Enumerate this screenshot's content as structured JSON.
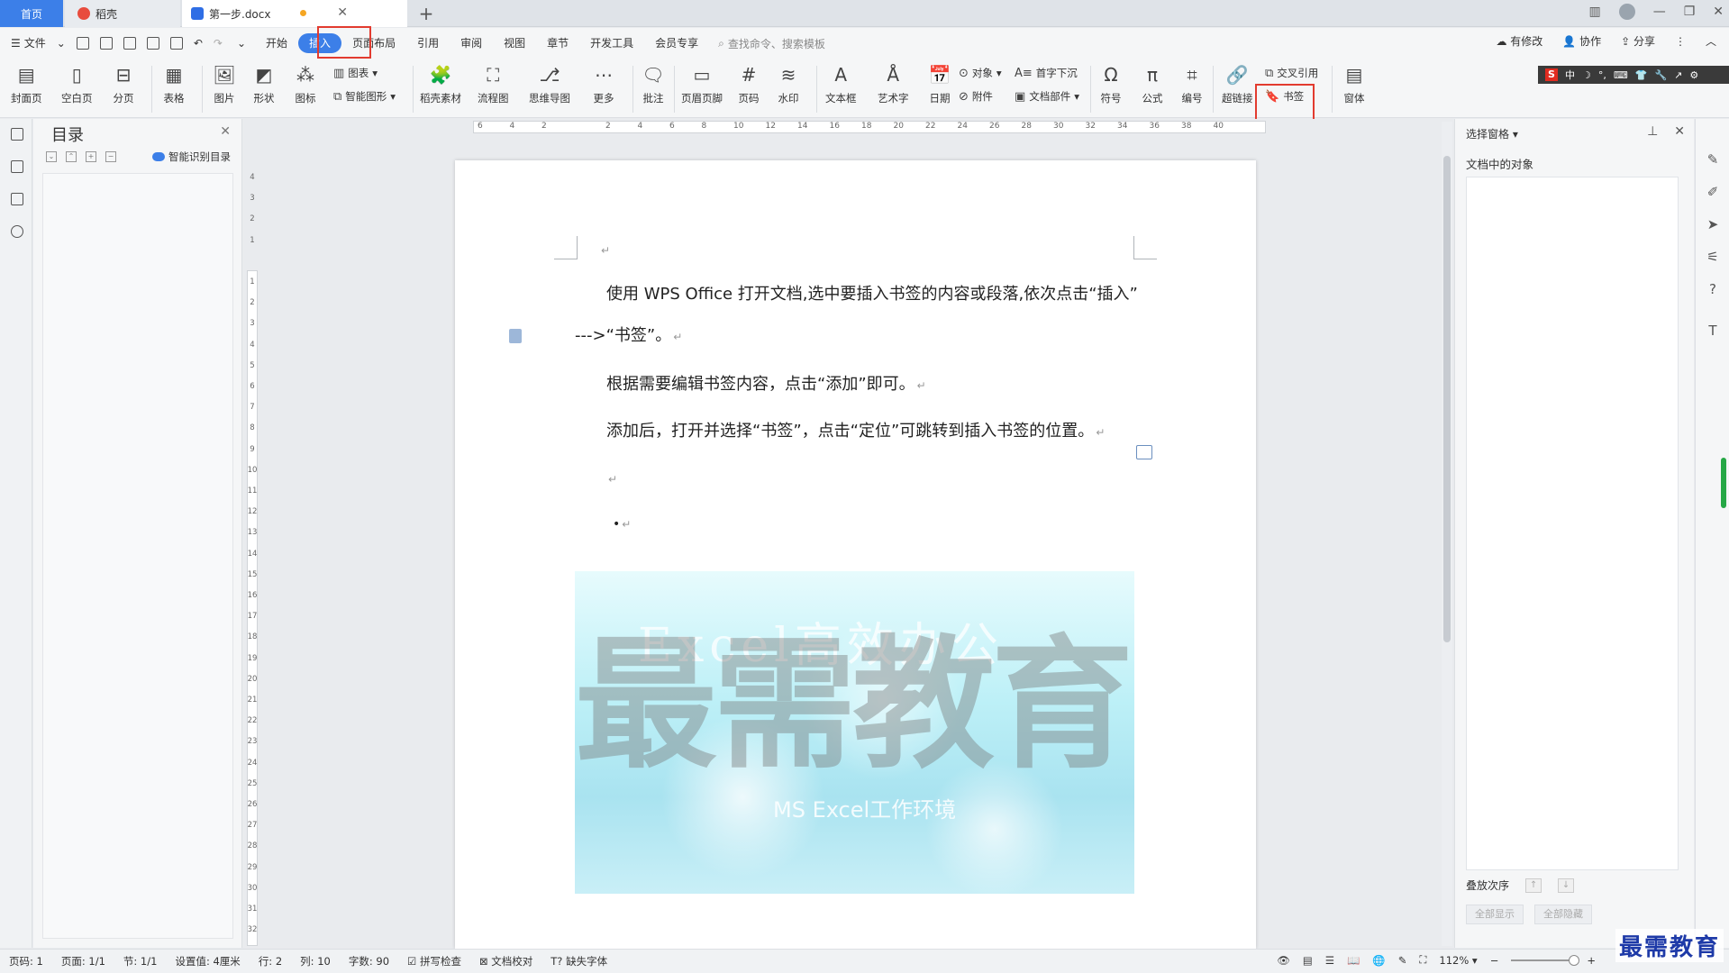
{
  "tabs": {
    "home": "首页",
    "daoke": "稻壳",
    "document": "第一步.docx"
  },
  "menu": {
    "file": "文件",
    "items": [
      "开始",
      "插入",
      "页面布局",
      "引用",
      "审阅",
      "视图",
      "章节",
      "开发工具",
      "会员专享"
    ],
    "active_index": 1,
    "search_placeholder": "查找命令、搜索模板",
    "right": [
      "有修改",
      "协作",
      "分享"
    ]
  },
  "ribbon": {
    "big": [
      "封面页",
      "空白页",
      "分页",
      "表格",
      "图片",
      "形状",
      "图标",
      "稻壳素材",
      "流程图",
      "思维导图",
      "更多",
      "批注",
      "页眉页脚",
      "页码",
      "水印",
      "文本框",
      "艺术字",
      "日期",
      "符号",
      "公式",
      "编号",
      "超链接",
      "窗体"
    ],
    "small": {
      "chart": "图表",
      "smart_shape": "智能图形",
      "object": "对象",
      "drop_cap": "首字下沉",
      "attachment": "附件",
      "doc_part": "文档部件",
      "cross_ref": "交叉引用",
      "bookmark": "书签"
    },
    "ime": [
      "中",
      "☽",
      "°,",
      "⌨",
      "👕",
      "🔧",
      "↗",
      "⚙"
    ]
  },
  "nav_panel": {
    "title": "目录",
    "smart_toc": "智能识别目录"
  },
  "ruler": {
    "h": [
      "6",
      "4",
      "2",
      "",
      "2",
      "4",
      "6",
      "8",
      "10",
      "12",
      "14",
      "16",
      "18",
      "20",
      "22",
      "24",
      "26",
      "28",
      "30",
      "32",
      "34",
      "36",
      "38",
      "40"
    ],
    "v": [
      "4",
      "3",
      "2",
      "1",
      "",
      "1",
      "2",
      "3",
      "4",
      "5",
      "6",
      "7",
      "8",
      "9",
      "10",
      "11",
      "12",
      "13",
      "14",
      "15",
      "16",
      "17",
      "18",
      "19",
      "20",
      "21",
      "22",
      "23",
      "24",
      "25",
      "26",
      "27",
      "28",
      "29",
      "30",
      "31",
      "32"
    ]
  },
  "document": {
    "line1": "使用 WPS Office 打开文档,选中要插入书签的内容或段落,依次点击“插入”",
    "line2": "--->“书签”。",
    "line3": "根据需要编辑书签内容，点击“添加”即可。",
    "line4": "添加后，打开并选择“书签”，点击“定位”可跳转到插入书签的位置。",
    "bullet": "•",
    "para_mark": "↵",
    "image_title": "Excel高效办公",
    "image_subtitle": "MS Excel工作环境",
    "watermark": "最需教育"
  },
  "right_panel": {
    "title": "选择窗格",
    "subtitle": "文档中的对象",
    "order_label": "叠放次序",
    "show_all": "全部显示",
    "hide_all": "全部隐藏"
  },
  "status": {
    "page_no": "页码: 1",
    "pages": "页面: 1/1",
    "section": "节: 1/1",
    "setting": "设置值: 4厘米",
    "row": "行: 2",
    "col": "列: 10",
    "words": "字数: 90",
    "spell": "拼写检查",
    "proof": "文档校对",
    "missing_font": "缺失字体",
    "zoom": "112%"
  },
  "brand": "最需教育",
  "colors": {
    "accent": "#3c7fe8",
    "highlight_box": "#e23b2f"
  }
}
